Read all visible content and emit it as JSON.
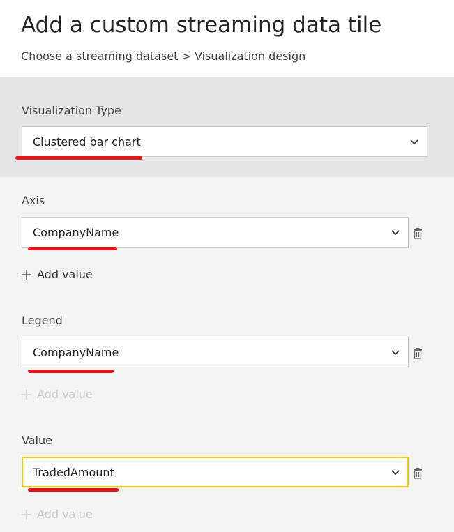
{
  "header": {
    "title": "Add a custom streaming data tile",
    "breadcrumb": "Choose a streaming dataset > Visualization design"
  },
  "visualization": {
    "label": "Visualization Type",
    "selected": "Clustered bar chart"
  },
  "axis": {
    "label": "Axis",
    "selected": "CompanyName",
    "add_label": "Add value"
  },
  "legend": {
    "label": "Legend",
    "selected": "CompanyName",
    "add_label": "Add value"
  },
  "value": {
    "label": "Value",
    "selected": "TradedAmount",
    "add_label": "Add value"
  },
  "colors": {
    "focus_border": "#f2c811",
    "annotation_underline": "#e3151a",
    "panel_gray": "#e6e6e6",
    "form_bg": "#f3f3f3"
  }
}
